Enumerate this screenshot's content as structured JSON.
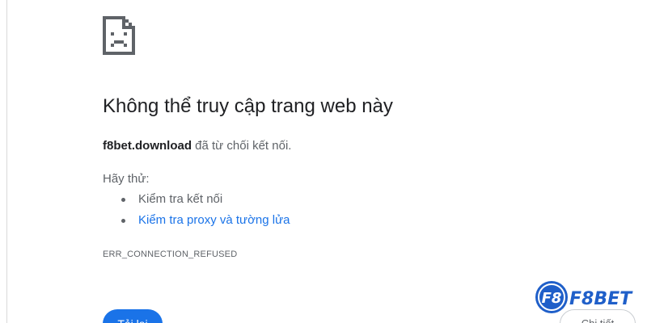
{
  "error_page": {
    "icon": "sad-page-icon",
    "heading": "Không thể truy cập trang web này",
    "host": "f8bet.download",
    "message": " đã từ chối kết nối.",
    "try_label": "Hãy thử:",
    "suggestions": [
      {
        "label": "Kiểm tra kết nối",
        "is_link": false
      },
      {
        "label": "Kiểm tra proxy và tường lửa",
        "is_link": true
      }
    ],
    "error_code": "ERR_CONNECTION_REFUSED",
    "reload_label": "Tải lại",
    "details_label": "Chi tiết"
  },
  "watermark": {
    "logo_text": "F8BET"
  },
  "colors": {
    "accent": "#1a73e8",
    "heading": "#202124",
    "body_text": "#5f6368",
    "logo_blue": "#1f5fc9"
  }
}
